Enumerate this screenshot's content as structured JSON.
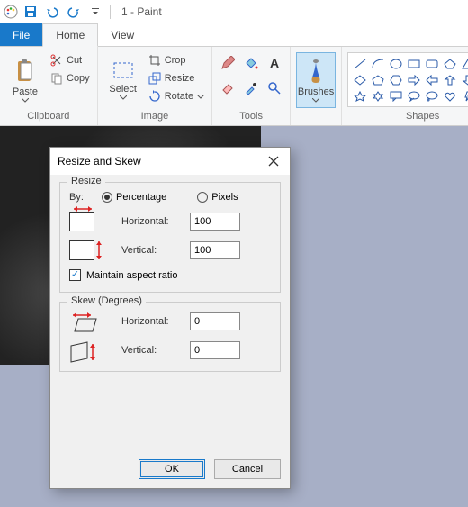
{
  "title": "1 - Paint",
  "tabs": {
    "file": "File",
    "home": "Home",
    "view": "View"
  },
  "clipboard": {
    "paste": "Paste",
    "cut": "Cut",
    "copy": "Copy",
    "group": "Clipboard"
  },
  "image": {
    "select": "Select",
    "crop": "Crop",
    "resize": "Resize",
    "rotate": "Rotate",
    "group": "Image"
  },
  "tools": {
    "group": "Tools"
  },
  "brushes": {
    "label": "Brushes"
  },
  "shapes": {
    "group": "Shapes"
  },
  "dialog": {
    "title": "Resize and Skew",
    "resize": {
      "legend": "Resize",
      "by": "By:",
      "percentage": "Percentage",
      "pixels": "Pixels",
      "horizontal": "Horizontal:",
      "vertical": "Vertical:",
      "hval": "100",
      "vval": "100",
      "maintain": "Maintain aspect ratio",
      "maintain_checked": true,
      "mode": "percentage"
    },
    "skew": {
      "legend": "Skew (Degrees)",
      "horizontal": "Horizontal:",
      "vertical": "Vertical:",
      "hval": "0",
      "vval": "0"
    },
    "ok": "OK",
    "cancel": "Cancel"
  }
}
